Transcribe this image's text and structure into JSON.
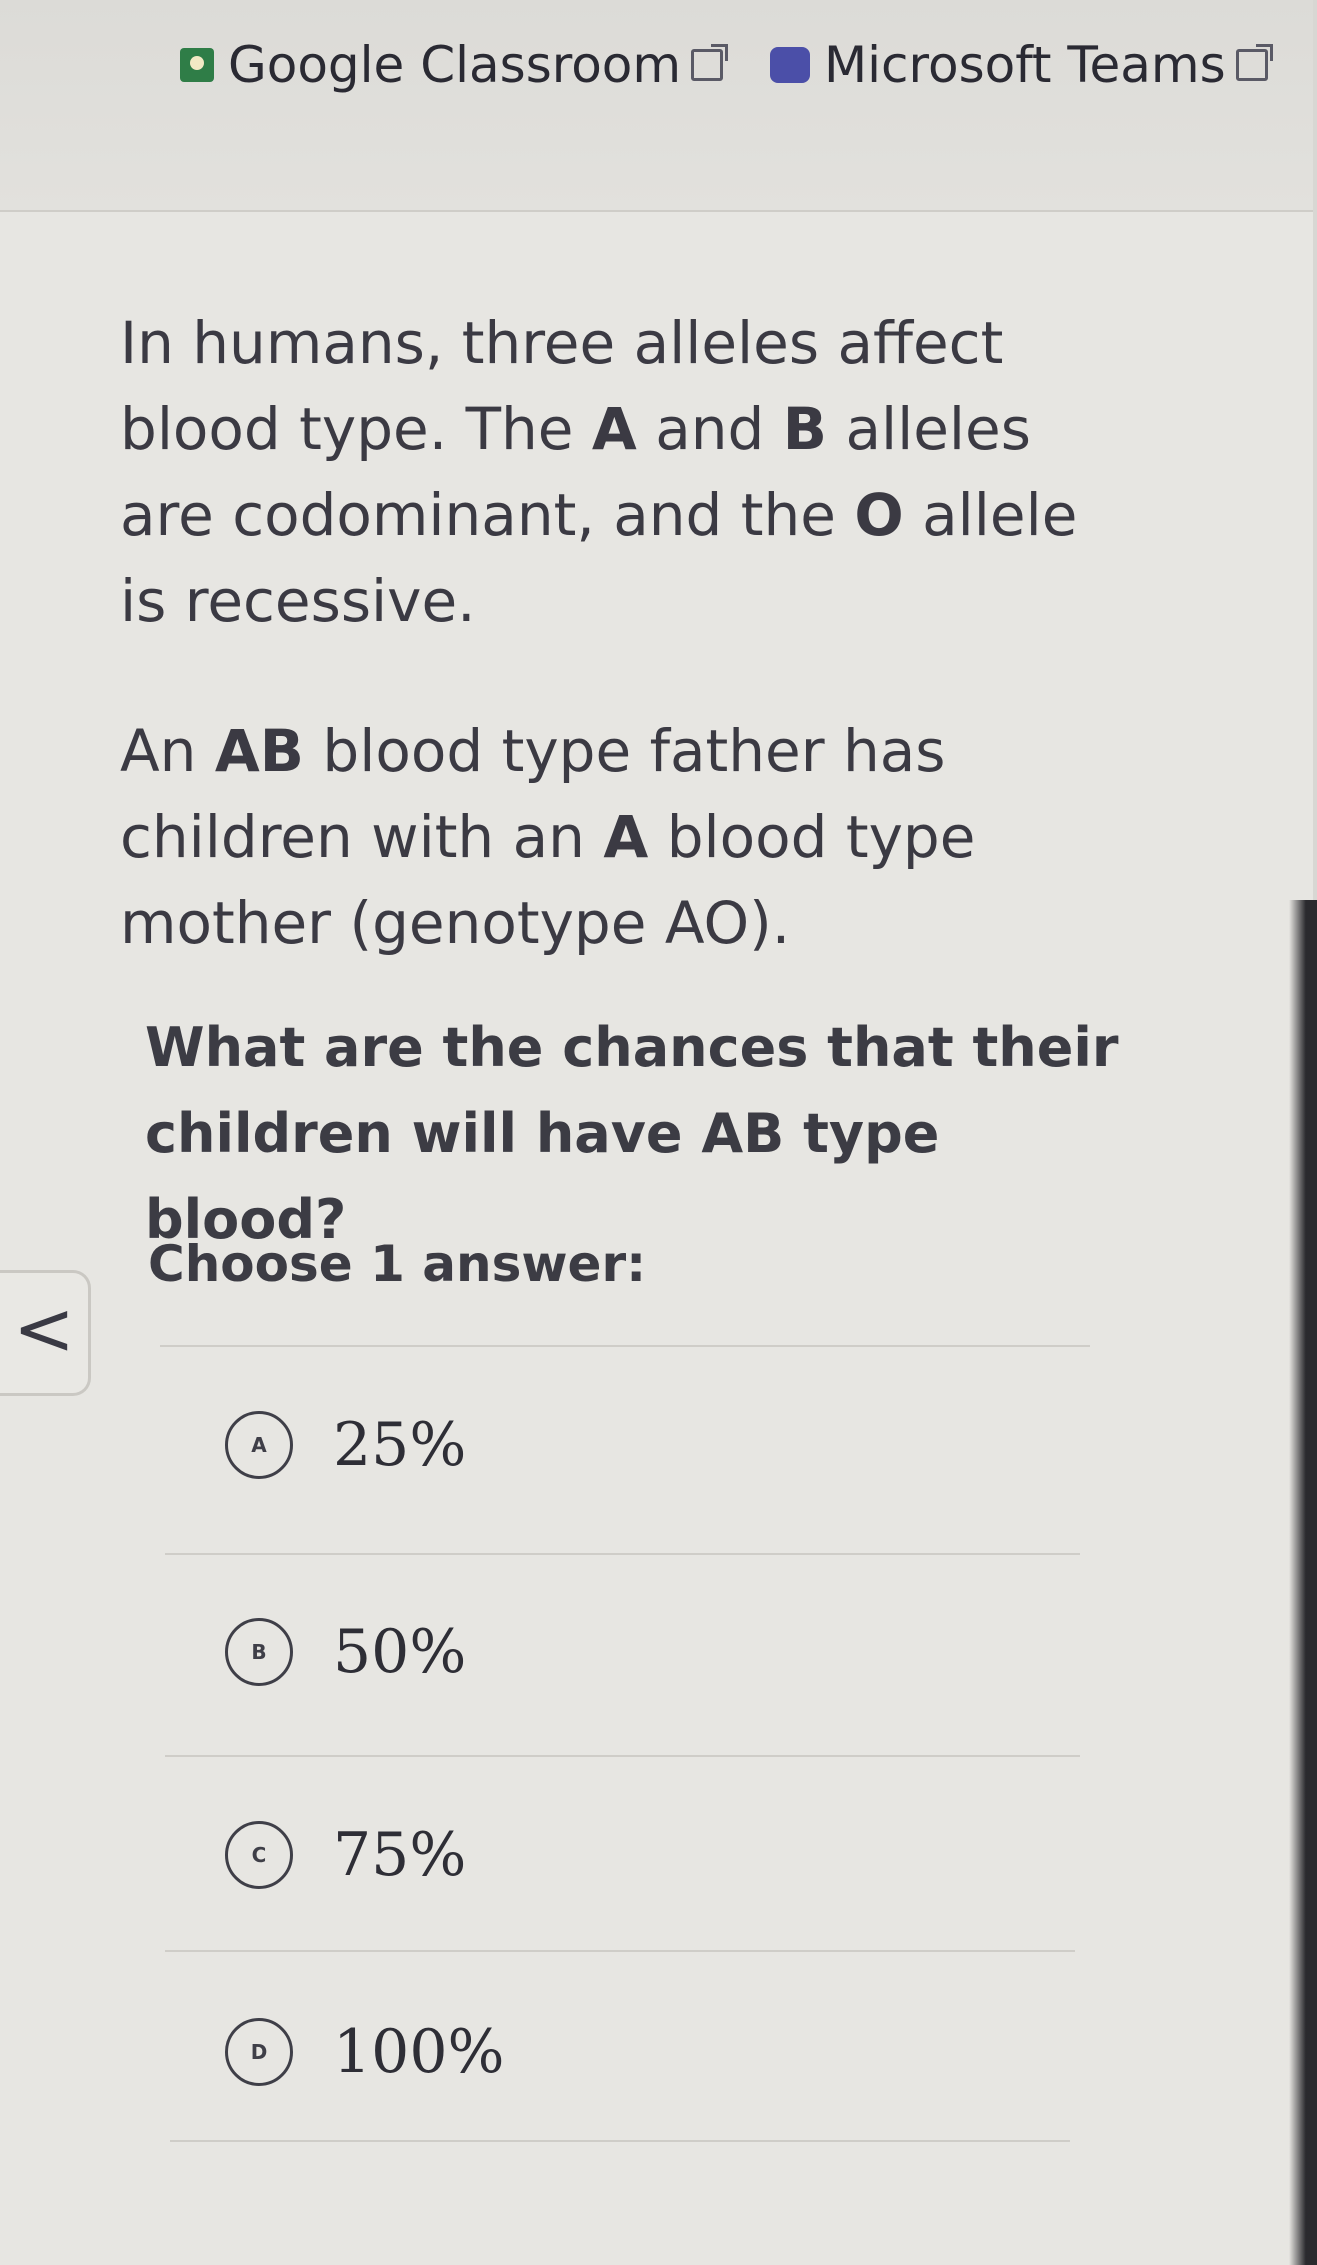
{
  "header": {
    "classroom_label": "Google Classroom",
    "teams_label": "Microsoft Teams"
  },
  "question": {
    "paragraph1": {
      "part1": "In humans, three alleles affect blood type. The ",
      "A": "A",
      "part2": " and ",
      "B": "B",
      "part3": " alleles are codominant, and the ",
      "O": "O",
      "part4": " allele is recessive."
    },
    "paragraph2": {
      "part1": "An ",
      "AB": "AB",
      "part2": " blood type father has children with an ",
      "A": "A",
      "part3": " blood type mother (genotype AO)."
    },
    "prompt": "What are the chances that their children will have AB type blood?",
    "choose_label": "Choose 1 answer:"
  },
  "options": [
    {
      "letter": "A",
      "value": "25%"
    },
    {
      "letter": "B",
      "value": "50%"
    },
    {
      "letter": "C",
      "value": "75%"
    },
    {
      "letter": "D",
      "value": "100%"
    }
  ],
  "back_glyph": "<"
}
